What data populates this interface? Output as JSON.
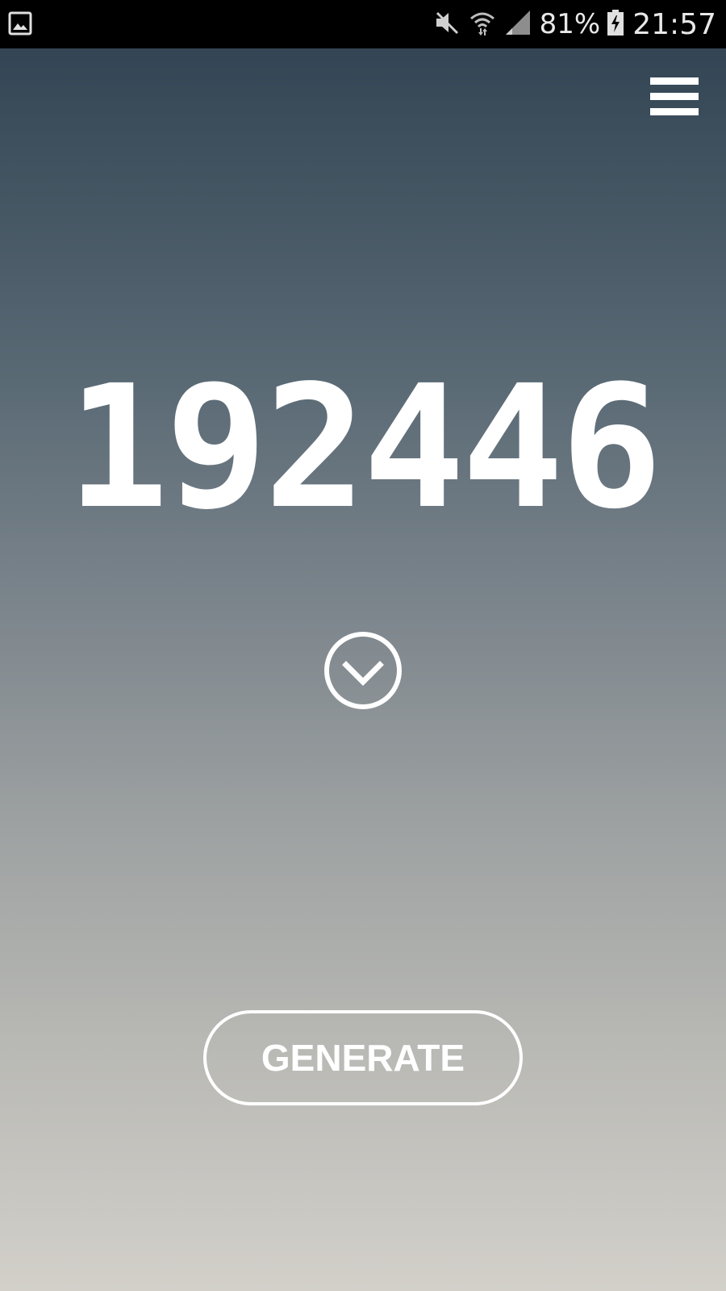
{
  "status_bar": {
    "left_icon": "gallery-notification-icon",
    "icons": [
      "mute-icon",
      "wifi-icon",
      "signal-icon"
    ],
    "battery_percent": "81%",
    "battery_icon": "battery-charging-icon",
    "time": "21:57"
  },
  "app": {
    "menu_icon": "hamburger-menu-icon",
    "code": "192446",
    "expand_icon": "chevron-down-circle-icon",
    "generate_label": "GENERATE"
  },
  "colors": {
    "gradient_top": "#334554",
    "gradient_bottom": "#d3d0ca",
    "foreground": "#ffffff",
    "status_bar_bg": "#000000"
  }
}
